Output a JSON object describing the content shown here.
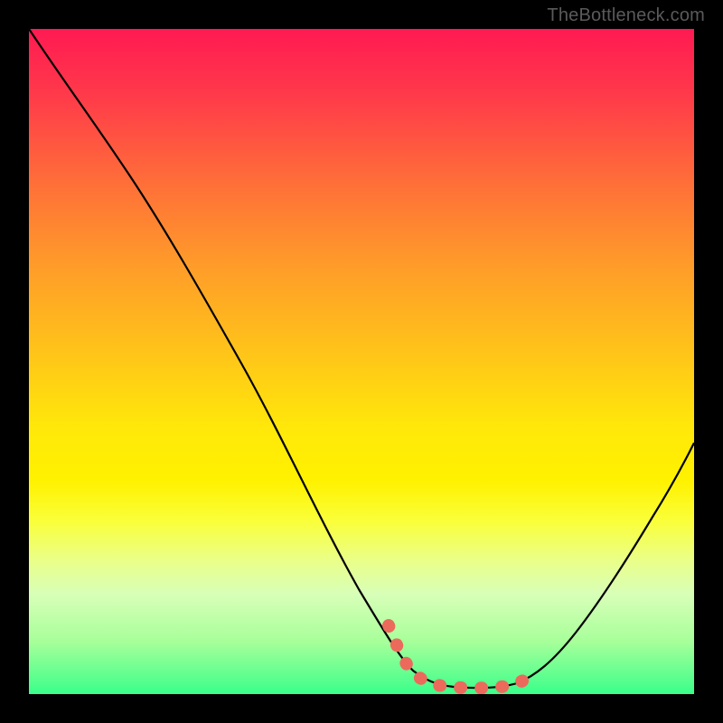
{
  "watermark": {
    "text": "TheBottleneck.com"
  },
  "chart_data": {
    "type": "line",
    "title": "",
    "xlabel": "",
    "ylabel": "",
    "xlim": [
      0,
      100
    ],
    "ylim": [
      0,
      100
    ],
    "series": [
      {
        "name": "bottleneck-curve",
        "color": "#000000",
        "x": [
          0,
          5,
          10,
          15,
          20,
          25,
          30,
          35,
          40,
          45,
          50,
          55,
          58,
          60,
          63,
          66,
          70,
          75,
          80,
          85,
          90,
          95,
          100
        ],
        "values": [
          100,
          93,
          85,
          77,
          69,
          61,
          52,
          43,
          34,
          25,
          17,
          10,
          6,
          4,
          3,
          2,
          2,
          3,
          6,
          12,
          20,
          30,
          42
        ]
      },
      {
        "name": "highlight-segment",
        "color": "#ec6a5c",
        "x": [
          52,
          55,
          58,
          60,
          63,
          66,
          70,
          73,
          75
        ],
        "values": [
          13,
          10,
          6,
          4,
          3,
          2,
          2,
          3,
          3
        ]
      }
    ],
    "annotations": []
  }
}
